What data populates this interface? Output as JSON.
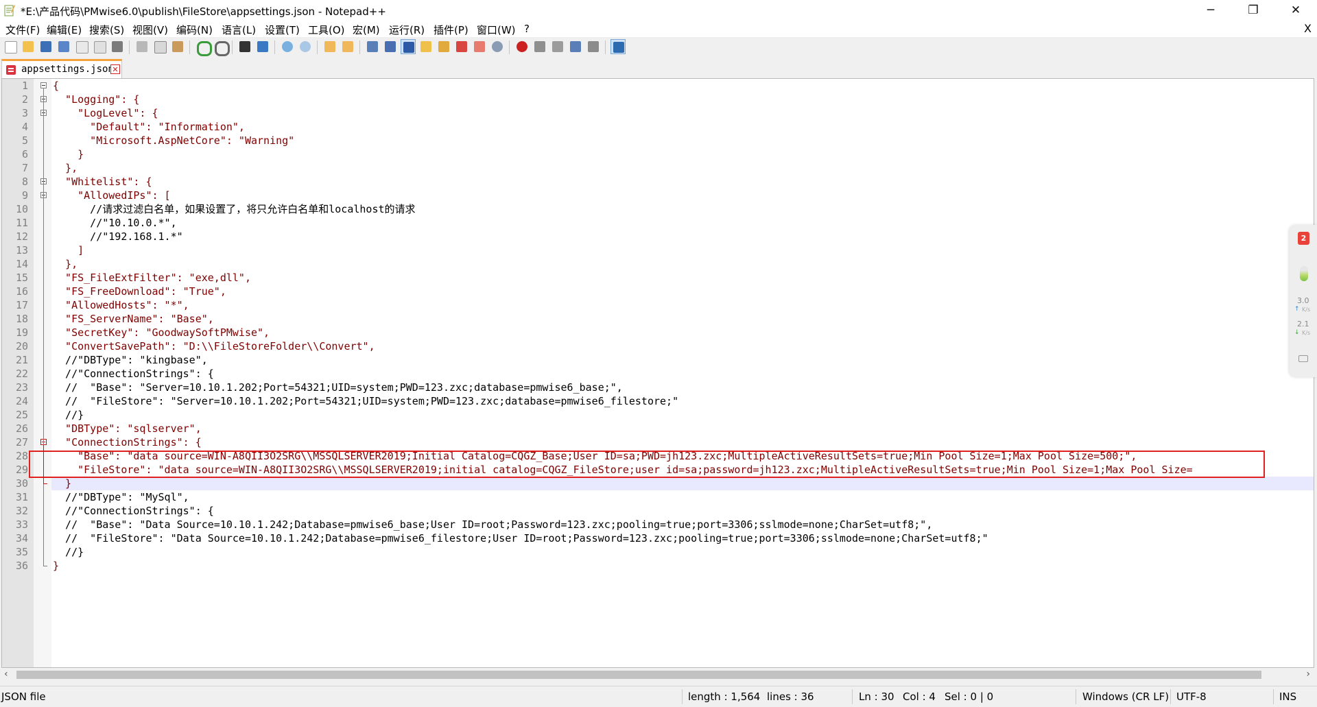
{
  "window": {
    "title": "*E:\\产品代码\\PMwise6.0\\publish\\FileStore\\appsettings.json - Notepad++",
    "minimize": "─",
    "maximize": "❐",
    "close": "✕"
  },
  "menu": {
    "items": [
      "文件(F)",
      "编辑(E)",
      "搜索(S)",
      "视图(V)",
      "编码(N)",
      "语言(L)",
      "设置(T)",
      "工具(O)",
      "宏(M)",
      "运行(R)",
      "插件(P)",
      "窗口(W)",
      "?"
    ],
    "close": "X"
  },
  "toolbar": {
    "buttons": [
      "new",
      "open",
      "save",
      "save-all",
      "close",
      "close-all",
      "print",
      "cut",
      "copy",
      "paste",
      "undo",
      "redo",
      "find",
      "replace",
      "zoom-in",
      "zoom-out",
      "sync-vertical",
      "sync-horizontal",
      "word-wrap",
      "show-all-chars",
      "indent-guide",
      "user-lang",
      "doc-map",
      "function-list",
      "folder-workspace",
      "monitor",
      "record-macro",
      "stop-record",
      "play-macro",
      "run-macro-multiple",
      "save-macro",
      "spell-check"
    ]
  },
  "tab": {
    "label": "appsettings.json",
    "close": "✕",
    "color": "#f6a23a"
  },
  "editor": {
    "lines": [
      "{",
      "  \"Logging\": {",
      "    \"LogLevel\": {",
      "      \"Default\": \"Information\",",
      "      \"Microsoft.AspNetCore\": \"Warning\"",
      "    }",
      "  },",
      "  \"Whitelist\": {",
      "    \"AllowedIPs\": [",
      "      //请求过滤白名单，如果设置了，将只允许白名单和localhost的请求",
      "      //\"10.10.0.*\",",
      "      //\"192.168.1.*\"",
      "    ]",
      "  },",
      "  \"FS_FileExtFilter\": \"exe,dll\",",
      "  \"FS_FreeDownload\": \"True\",",
      "  \"AllowedHosts\": \"*\",",
      "  \"FS_ServerName\": \"Base\",",
      "  \"SecretKey\": \"GoodwaySoftPMwise\",",
      "  \"ConvertSavePath\": \"D:\\\\FileStoreFolder\\\\Convert\",",
      "  //\"DBType\": \"kingbase\",",
      "  //\"ConnectionStrings\": {",
      "  //  \"Base\": \"Server=10.10.1.202;Port=54321;UID=system;PWD=123.zxc;database=pmwise6_base;\",",
      "  //  \"FileStore\": \"Server=10.10.1.202;Port=54321;UID=system;PWD=123.zxc;database=pmwise6_filestore;\"",
      "  //}",
      "  \"DBType\": \"sqlserver\",",
      "  \"ConnectionStrings\": {",
      "    \"Base\": \"data source=WIN-A8QII3O2SRG\\\\MSSQLSERVER2019;Initial Catalog=CQGZ_Base;User ID=sa;PWD=jh123.zxc;MultipleActiveResultSets=true;Min Pool Size=1;Max Pool Size=500;\",",
      "    \"FileStore\": \"data source=WIN-A8QII3O2SRG\\\\MSSQLSERVER2019;initial catalog=CQGZ_FileStore;user id=sa;password=jh123.zxc;MultipleActiveResultSets=true;Min Pool Size=1;Max Pool Size=",
      "  }",
      "  //\"DBType\": \"MySql\",",
      "  //\"ConnectionStrings\": {",
      "  //  \"Base\": \"Data Source=10.10.1.242;Database=pmwise6_base;User ID=root;Password=123.zxc;pooling=true;port=3306;sslmode=none;CharSet=utf8;\",",
      "  //  \"FileStore\": \"Data Source=10.10.1.242;Database=pmwise6_filestore;User ID=root;Password=123.zxc;pooling=true;port=3306;sslmode=none;CharSet=utf8;\"",
      "  //}",
      "}"
    ],
    "current_line": 30,
    "highlight_color": "#e01f1f",
    "fold_open_lines": [
      1,
      2,
      3,
      8,
      9,
      27
    ]
  },
  "side_panel": {
    "badge": "2",
    "up_speed": "3.0",
    "up_unit": "K/s",
    "down_speed": "2.1",
    "down_unit": "K/s"
  },
  "status": {
    "file_type": "JSON file",
    "length": "length : 1,564",
    "lines": "lines : 36",
    "ln": "Ln : 30",
    "col": "Col : 4",
    "sel": "Sel : 0 | 0",
    "eol": "Windows (CR LF)",
    "encoding": "UTF-8",
    "mode": "INS"
  }
}
